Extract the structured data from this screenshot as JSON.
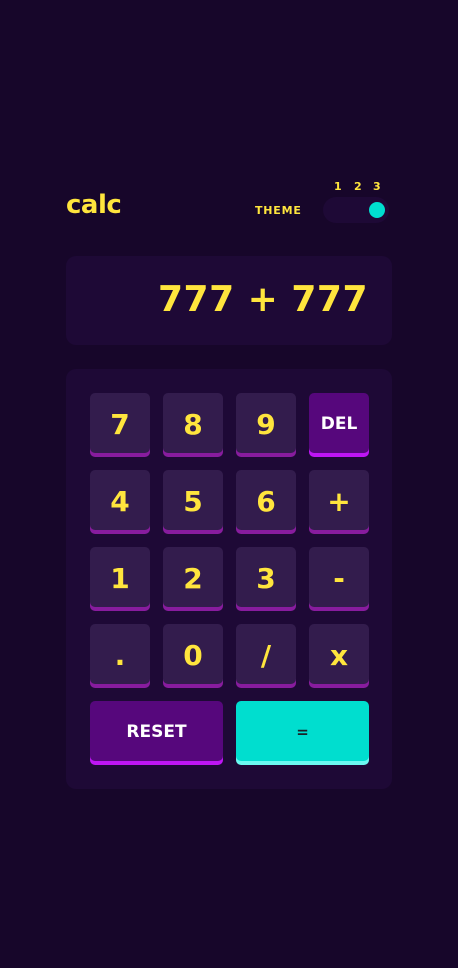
{
  "header": {
    "logo": "calc",
    "theme_label": "THEME",
    "theme_options": [
      "1",
      "2",
      "3"
    ],
    "theme_selected": 3
  },
  "display": {
    "value": "777 + 777"
  },
  "keys": {
    "k7": "7",
    "k8": "8",
    "k9": "9",
    "del": "DEL",
    "k4": "4",
    "k5": "5",
    "k6": "6",
    "plus": "+",
    "k1": "1",
    "k2": "2",
    "k3": "3",
    "minus": "-",
    "dot": ".",
    "k0": "0",
    "divide": "/",
    "times": "x",
    "reset": "RESET",
    "equals": "="
  },
  "colors": {
    "background": "#17062a",
    "panel": "#1e0936",
    "key": "#331c4d",
    "key_shadow": "#881c9e",
    "accent_text": "#ffe53d",
    "action_key": "#56077c",
    "equals_key": "#00decf"
  }
}
